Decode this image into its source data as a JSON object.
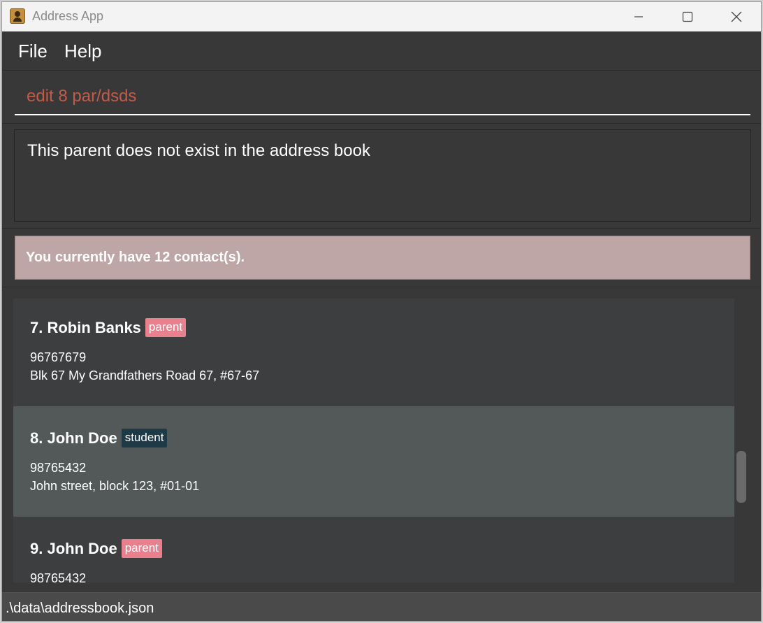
{
  "window": {
    "title": "Address App",
    "icon": "address-book-icon"
  },
  "menu": {
    "file": "File",
    "help": "Help"
  },
  "command": {
    "value": "edit 8 par/dsds"
  },
  "result": {
    "message": "This parent does not exist in the address book"
  },
  "summary": {
    "text": "You currently have 12 contact(s)."
  },
  "contacts": [
    {
      "name": "7. Robin Banks",
      "tag": "parent",
      "phone": "96767679",
      "address": "Blk 67 My Grandfathers Road 67, #67-67",
      "selected": false
    },
    {
      "name": "8. John Doe",
      "tag": "student",
      "phone": "98765432",
      "address": "John street, block 123, #01-01",
      "selected": true
    },
    {
      "name": "9. John Doe",
      "tag": "parent",
      "phone": "98765432",
      "address": "",
      "selected": false
    }
  ],
  "footer": {
    "file_path": ".\\data\\addressbook.json"
  },
  "colors": {
    "parent_tag": "#ea7f8e",
    "student_tag": "#1d3a46",
    "summary_bg": "#bea6a6",
    "command_text": "#c65a48",
    "selected_card": "#535859"
  }
}
